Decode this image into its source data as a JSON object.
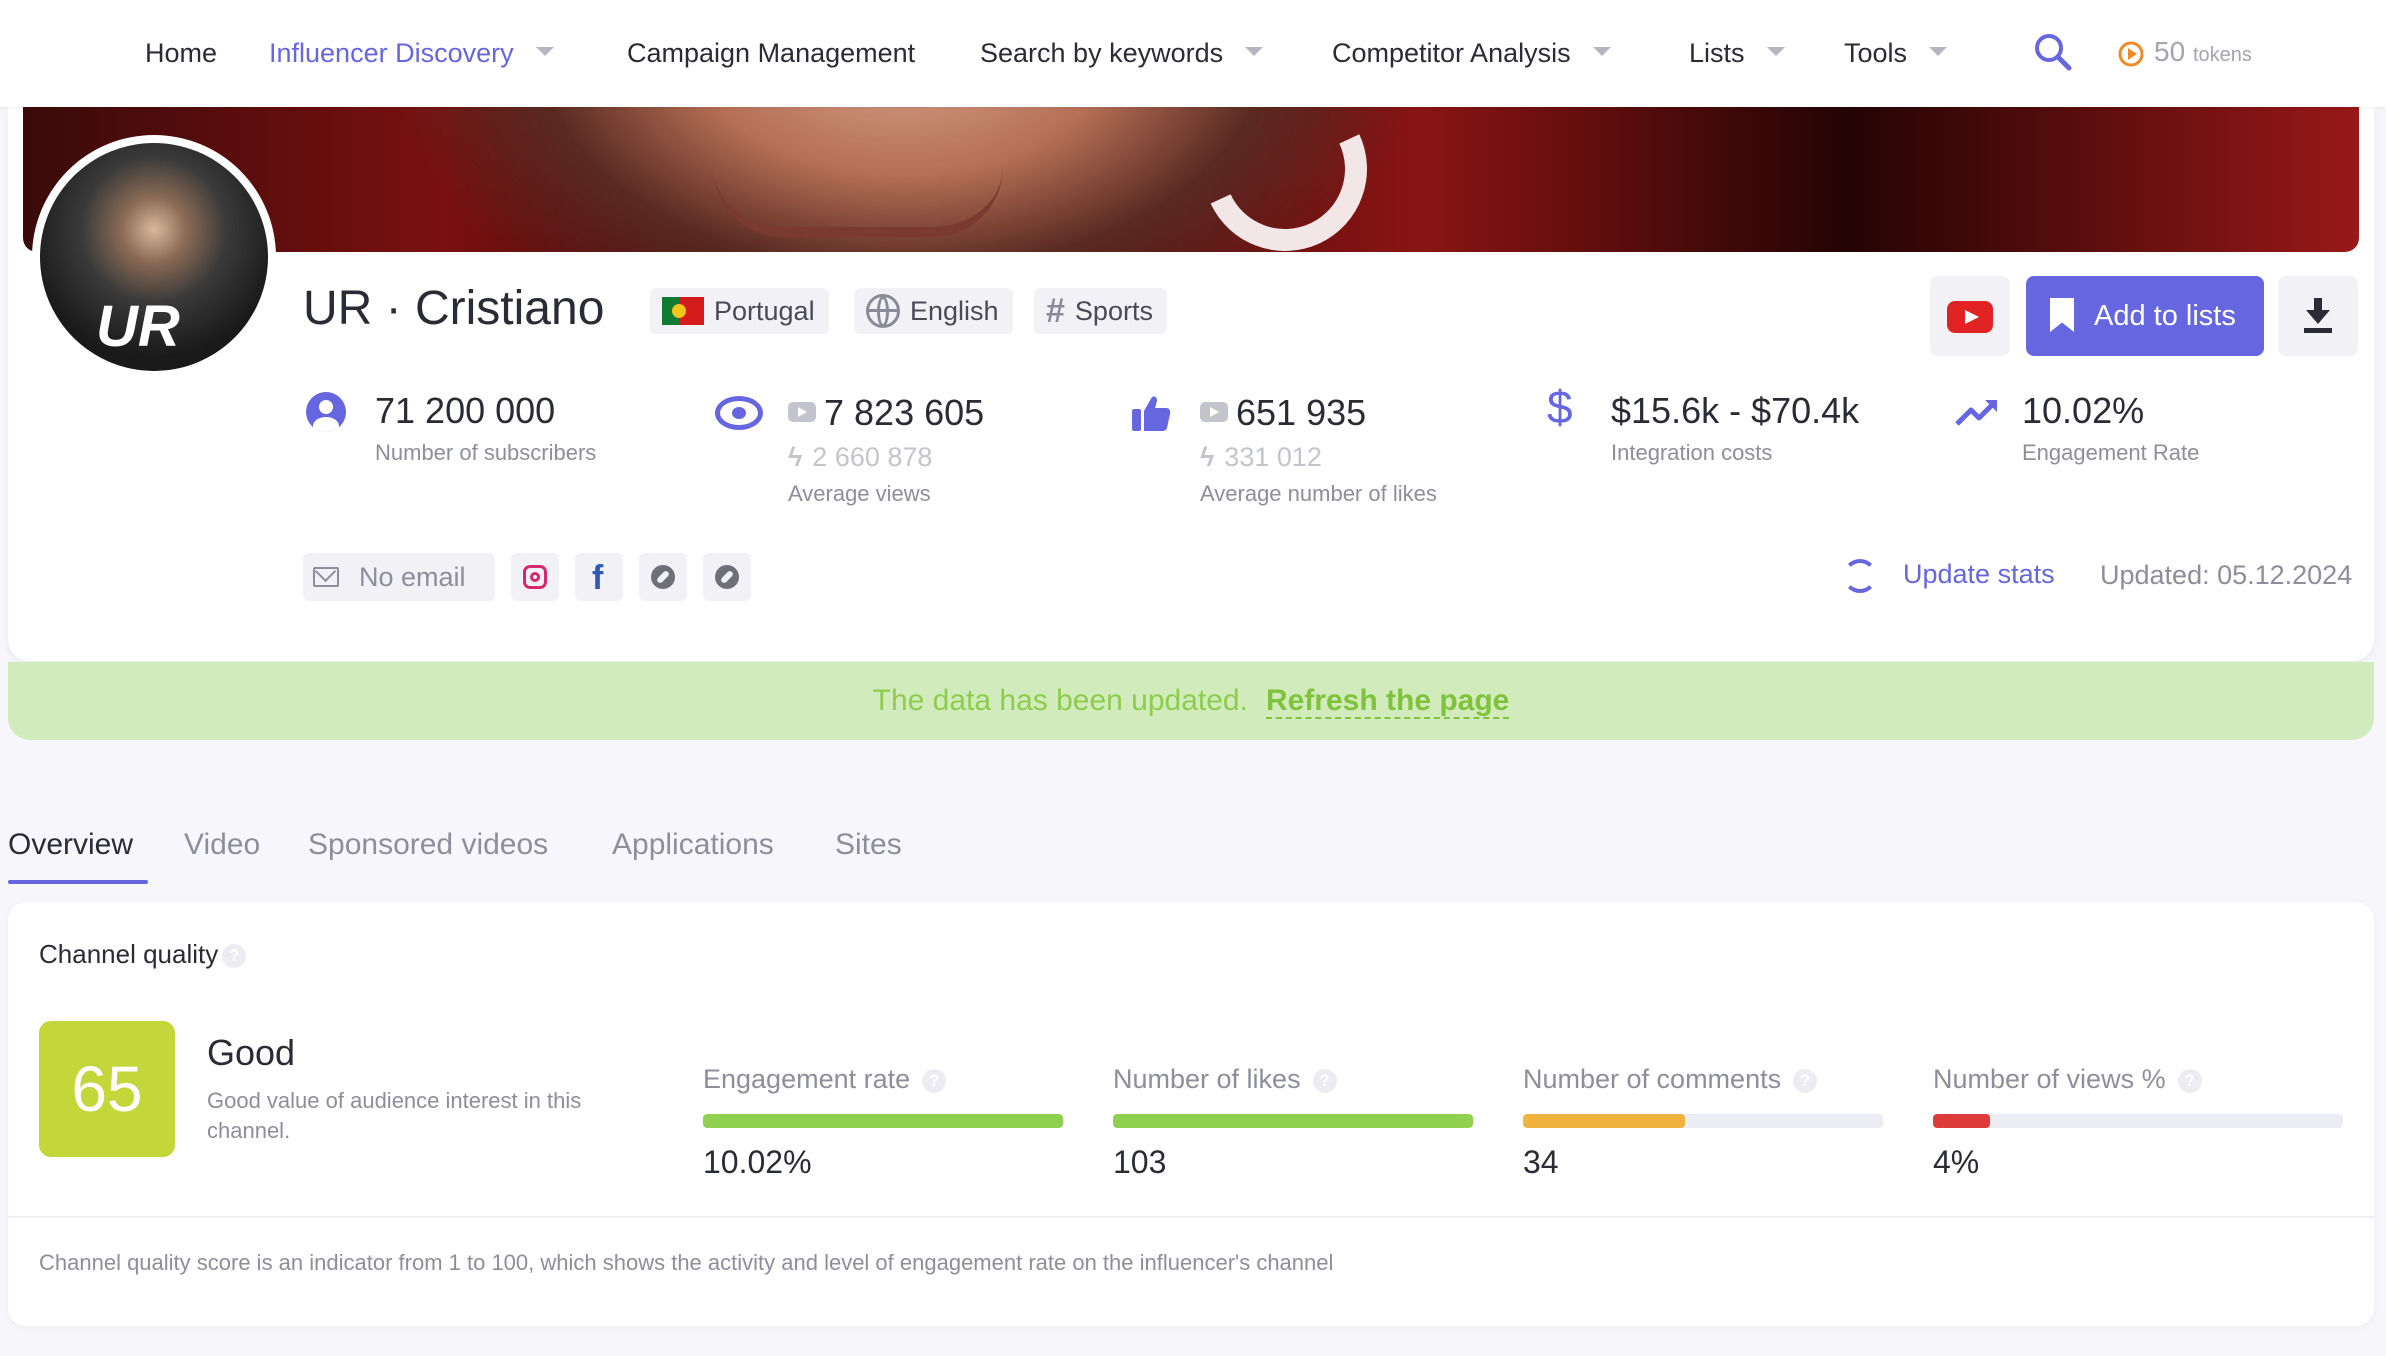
{
  "nav": {
    "items": [
      {
        "label": "Home",
        "has_caret": false
      },
      {
        "label": "Influencer Discovery",
        "has_caret": true,
        "active": true
      },
      {
        "label": "Campaign Management",
        "has_caret": false
      },
      {
        "label": "Search by keywords",
        "has_caret": true
      },
      {
        "label": "Competitor Analysis",
        "has_caret": true
      },
      {
        "label": "Lists",
        "has_caret": true
      },
      {
        "label": "Tools",
        "has_caret": true
      }
    ],
    "tokens_count": "50",
    "tokens_label": "tokens"
  },
  "profile": {
    "name": "UR · Cristiano",
    "country": "Portugal",
    "language": "English",
    "category": "Sports",
    "add_to_lists_label": "Add to lists"
  },
  "stats": {
    "subscribers": {
      "value": "71 200 000",
      "label": "Number of subscribers"
    },
    "views": {
      "value": "7 823 605",
      "sub_value": "2 660 878",
      "label": "Average views"
    },
    "likes": {
      "value": "651 935",
      "sub_value": "331 012",
      "label": "Average number of likes"
    },
    "integration": {
      "value": "$15.6k - $70.4k",
      "label": "Integration costs"
    },
    "engagement": {
      "value": "10.02%",
      "label": "Engagement Rate"
    }
  },
  "contacts": {
    "email_label": "No email"
  },
  "update": {
    "label": "Update stats",
    "updated_text": "Updated: 05.12.2024"
  },
  "notice": {
    "text": "The data has been updated.",
    "link": "Refresh the page"
  },
  "tabs": [
    "Overview",
    "Video",
    "Sponsored videos",
    "Applications",
    "Sites"
  ],
  "active_tab": "Overview",
  "quality": {
    "title": "Channel quality",
    "score": "65",
    "rating": "Good",
    "description": "Good value of audience interest in this channel.",
    "metrics": [
      {
        "label": "Engagement rate",
        "value": "10.02%",
        "level": 1.0,
        "color": "#8fd14f"
      },
      {
        "label": "Number of likes",
        "value": "103",
        "level": 1.0,
        "color": "#8fd14f"
      },
      {
        "label": "Number of comments",
        "value": "34",
        "level": 0.45,
        "color": "#f0b33f"
      },
      {
        "label": "Number of views %",
        "value": "4%",
        "level": 0.14,
        "color": "#dd3a3a"
      }
    ],
    "footnote": "Channel quality score is an indicator from 1 to 100, which shows the activity and level of engagement rate on the influencer's channel"
  },
  "colors": {
    "accent": "#6566e0",
    "score_bg": "#c3d73b",
    "notice_bg": "#d1ebbc",
    "notice_text": "#8dcc4d"
  }
}
